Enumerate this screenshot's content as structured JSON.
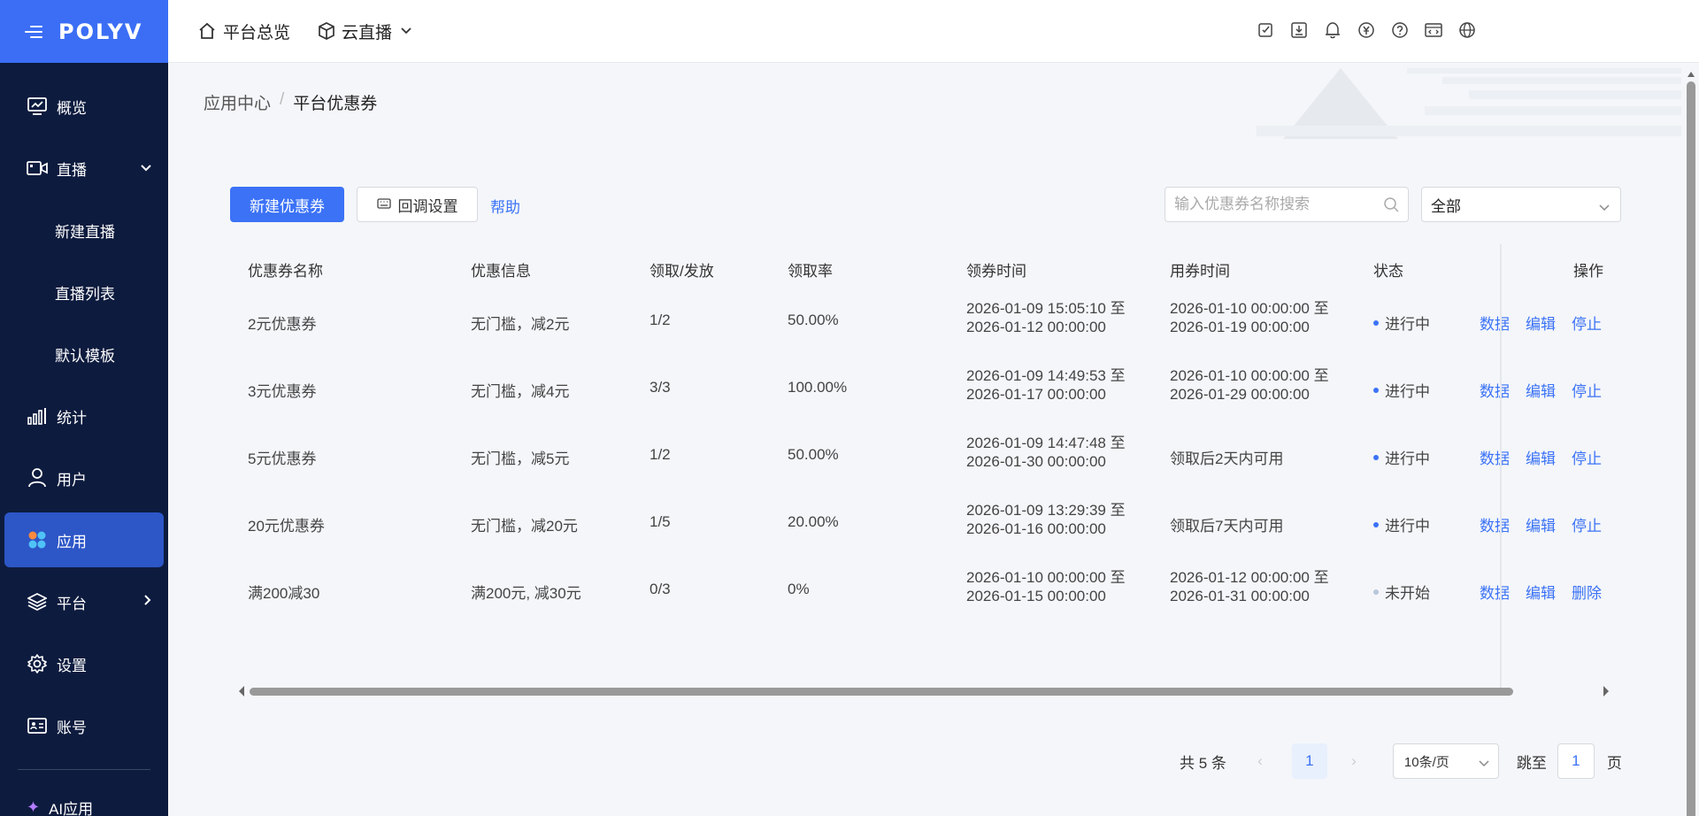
{
  "brand": {
    "logo": "POLYV"
  },
  "sidebar": {
    "items": [
      {
        "label": "概览"
      },
      {
        "label": "直播"
      },
      {
        "label": "新建直播"
      },
      {
        "label": "直播列表"
      },
      {
        "label": "默认模板"
      },
      {
        "label": "统计"
      },
      {
        "label": "用户"
      },
      {
        "label": "应用"
      },
      {
        "label": "平台"
      },
      {
        "label": "设置"
      },
      {
        "label": "账号"
      },
      {
        "label": "AI应用"
      }
    ]
  },
  "topbar": {
    "home_label": "平台总览",
    "product_label": "云直播"
  },
  "breadcrumb": {
    "parent": "应用中心",
    "separator": "/",
    "current": "平台优惠券"
  },
  "toolbar": {
    "new_coupon": "新建优惠券",
    "callback_settings": "回调设置",
    "help": "帮助",
    "search_placeholder": "输入优惠券名称搜索",
    "filter_value": "全部"
  },
  "table": {
    "headers": [
      "优惠券名称",
      "优惠信息",
      "领取/发放",
      "领取率",
      "领券时间",
      "用券时间",
      "状态",
      "操作"
    ],
    "rows": [
      {
        "name": "2元优惠券",
        "info": "无门槛，减2元",
        "ratio": "1/2",
        "rate": "50.00%",
        "claim_l1": "2026-01-09 15:05:10 至",
        "claim_l2": "2026-01-12 00:00:00",
        "use_l1": "2026-01-10 00:00:00 至",
        "use_l2": "2026-01-19 00:00:00",
        "status": "进行中",
        "op1": "数据",
        "op2": "编辑",
        "op3": "停止"
      },
      {
        "name": "3元优惠券",
        "info": "无门槛，减4元",
        "ratio": "3/3",
        "rate": "100.00%",
        "claim_l1": "2026-01-09 14:49:53 至",
        "claim_l2": "2026-01-17 00:00:00",
        "use_l1": "2026-01-10 00:00:00 至",
        "use_l2": "2026-01-29 00:00:00",
        "status": "进行中",
        "op1": "数据",
        "op2": "编辑",
        "op3": "停止"
      },
      {
        "name": "5元优惠券",
        "info": "无门槛，减5元",
        "ratio": "1/2",
        "rate": "50.00%",
        "claim_l1": "2026-01-09 14:47:48 至",
        "claim_l2": "2026-01-30 00:00:00",
        "use_single": "领取后2天内可用",
        "status": "进行中",
        "op1": "数据",
        "op2": "编辑",
        "op3": "停止"
      },
      {
        "name": "20元优惠券",
        "info": "无门槛，减20元",
        "ratio": "1/5",
        "rate": "20.00%",
        "claim_l1": "2026-01-09 13:29:39 至",
        "claim_l2": "2026-01-16 00:00:00",
        "use_single": "领取后7天内可用",
        "status": "进行中",
        "op1": "数据",
        "op2": "编辑",
        "op3": "停止"
      },
      {
        "name": "满200减30",
        "info": "满200元, 减30元",
        "ratio": "0/3",
        "rate": "0%",
        "claim_l1": "2026-01-10 00:00:00 至",
        "claim_l2": "2026-01-15 00:00:00",
        "use_l1": "2026-01-12 00:00:00 至",
        "use_l2": "2026-01-31 00:00:00",
        "status": "未开始",
        "op1": "数据",
        "op2": "编辑",
        "op3": "删除"
      }
    ]
  },
  "pagination": {
    "total": "共 5 条",
    "current_page": "1",
    "page_size": "10条/页",
    "jump_label": "跳至",
    "jump_value": "1",
    "page_suffix": "页"
  },
  "colors": {
    "sidebar_bg": "#0d1b3e",
    "brand_bg": "#3b6ef5",
    "active_item": "#2d56c7",
    "primary": "#3b72f6",
    "status_active": "#3b72f6",
    "status_pending": "#b9c6d8"
  }
}
